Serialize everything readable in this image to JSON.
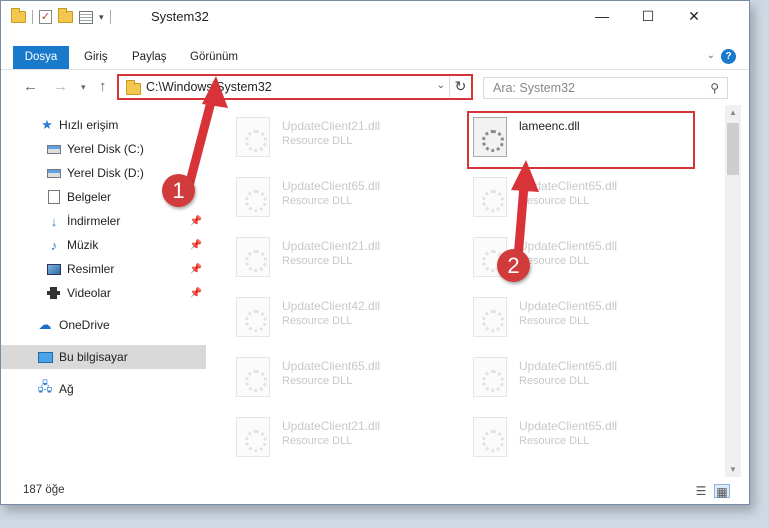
{
  "window": {
    "title": "System32",
    "controls": {
      "minimize": "—",
      "maximize": "☐",
      "close": "✕"
    }
  },
  "ribbon": {
    "tabs": [
      "Dosya",
      "Giriş",
      "Paylaş",
      "Görünüm"
    ],
    "help": "?"
  },
  "address": {
    "path": "C:\\Windows\\System32",
    "search_placeholder": "Ara: System32"
  },
  "sidebar": {
    "items": [
      {
        "label": "Hızlı erişim",
        "icon": "star-icon"
      },
      {
        "label": "Yerel Disk (C:)",
        "icon": "drive-icon"
      },
      {
        "label": "Yerel Disk (D:)",
        "icon": "drive-icon"
      },
      {
        "label": "Belgeler",
        "icon": "documents-icon"
      },
      {
        "label": "İndirmeler",
        "icon": "download-icon"
      },
      {
        "label": "Müzik",
        "icon": "music-icon"
      },
      {
        "label": "Resimler",
        "icon": "pictures-icon"
      },
      {
        "label": "Videolar",
        "icon": "videos-icon"
      },
      {
        "label": "OneDrive",
        "icon": "cloud-icon"
      },
      {
        "label": "Bu bilgisayar",
        "icon": "computer-icon"
      },
      {
        "label": "Ağ",
        "icon": "network-icon"
      }
    ]
  },
  "files": {
    "left": [
      {
        "name": "UpdateClient21.dll",
        "type": "Resource DLL"
      },
      {
        "name": "UpdateClient65.dll",
        "type": "Resource DLL"
      },
      {
        "name": "UpdateClient21.dll",
        "type": "Resource DLL"
      },
      {
        "name": "UpdateClient42.dll",
        "type": "Resource DLL"
      },
      {
        "name": "UpdateClient65.dll",
        "type": "Resource DLL"
      },
      {
        "name": "UpdateClient21.dll",
        "type": "Resource DLL"
      }
    ],
    "right": [
      {
        "name": "lameenc.dll",
        "type": ""
      },
      {
        "name": "UpdateClient65.dll",
        "type": "Resource DLL"
      },
      {
        "name": "UpdateClient65.dll",
        "type": "Resource DLL"
      },
      {
        "name": "UpdateClient65.dll",
        "type": "Resource DLL"
      },
      {
        "name": "UpdateClient65.dll",
        "type": "Resource DLL"
      },
      {
        "name": "UpdateClient65.dll",
        "type": "Resource DLL"
      }
    ]
  },
  "status": {
    "count": "187 öğe"
  },
  "annotations": {
    "step1": "1",
    "step2": "2",
    "color": "#d9333a"
  }
}
